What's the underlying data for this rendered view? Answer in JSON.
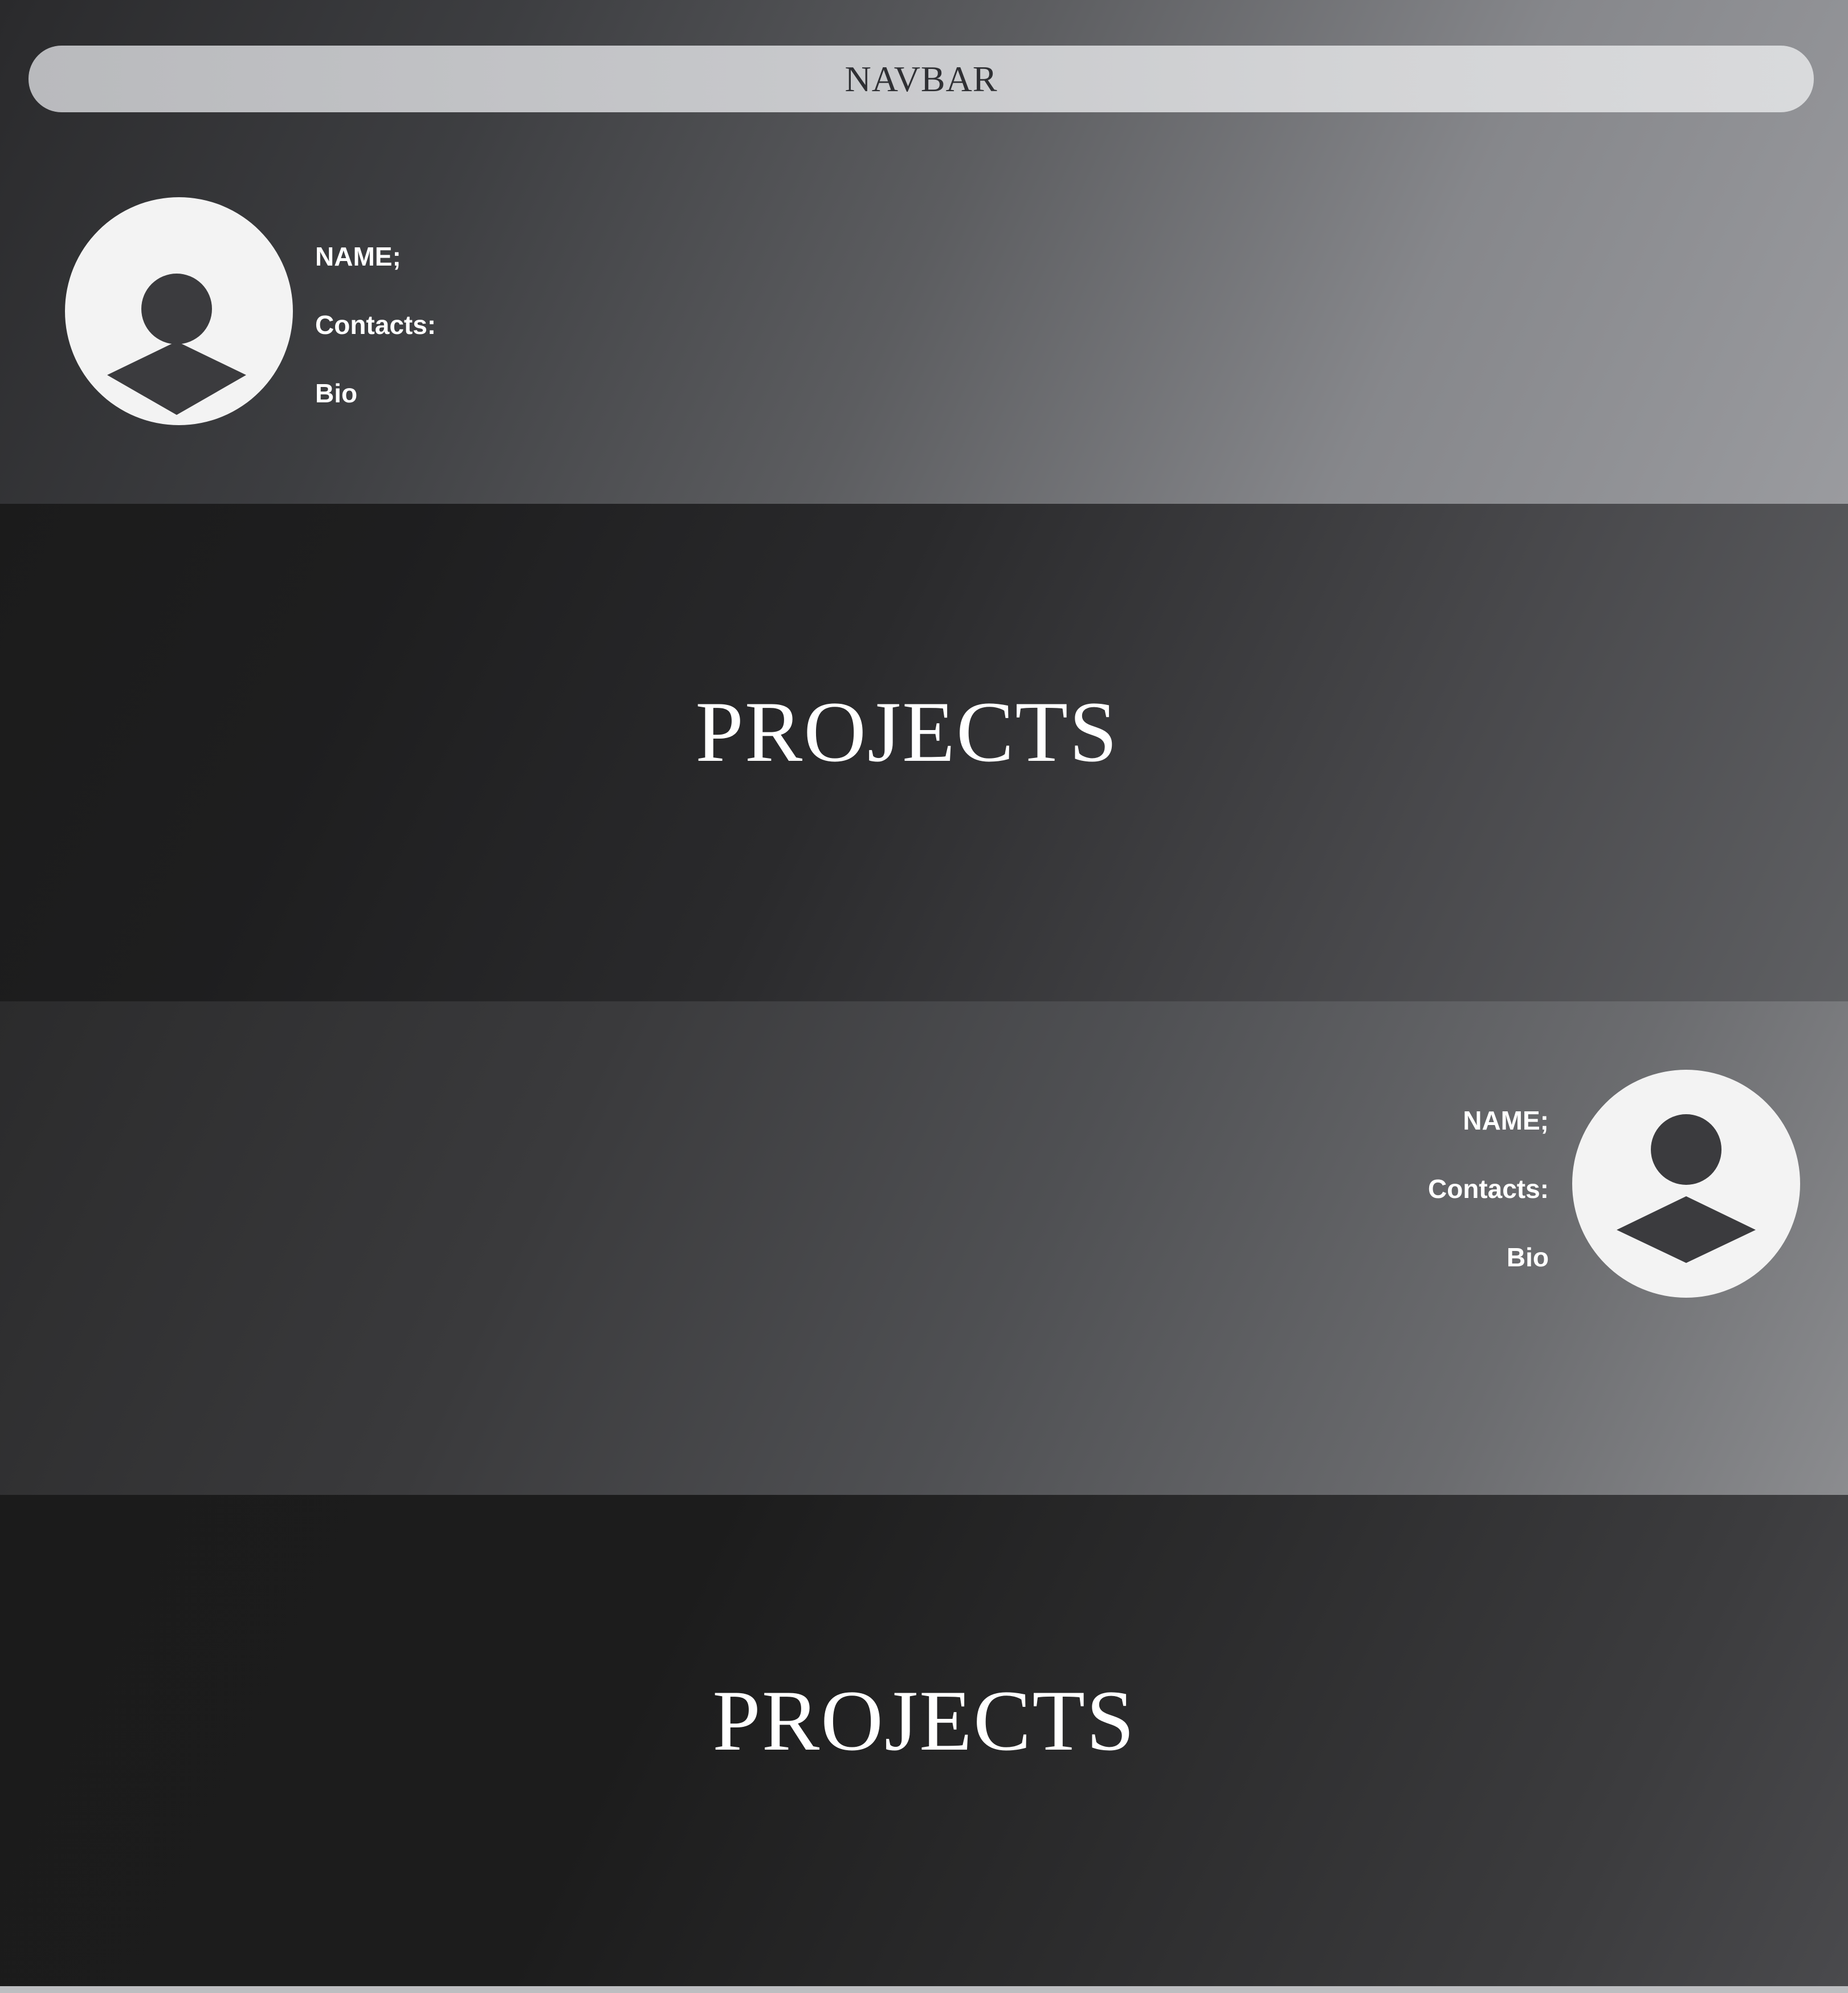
{
  "navbar": {
    "label": "NAVBAR"
  },
  "profile_top": {
    "name_label": "NAME;",
    "contacts_label": "Contacts:",
    "bio_label": "Bio",
    "avatar_icon": "user-avatar-icon"
  },
  "projects_1": {
    "title": "PROJECTS"
  },
  "profile_bottom": {
    "name_label": "NAME;",
    "contacts_label": "Contacts:",
    "bio_label": "Bio",
    "avatar_icon": "user-avatar-icon"
  },
  "projects_2": {
    "title": "PROJECTS"
  },
  "colors": {
    "avatar_bg": "#f3f3f3",
    "avatar_figure": "#3b3b3e",
    "navbar_bg": "#c6c7ca",
    "navbar_text": "#2f3034",
    "text_light": "#ffffff"
  }
}
